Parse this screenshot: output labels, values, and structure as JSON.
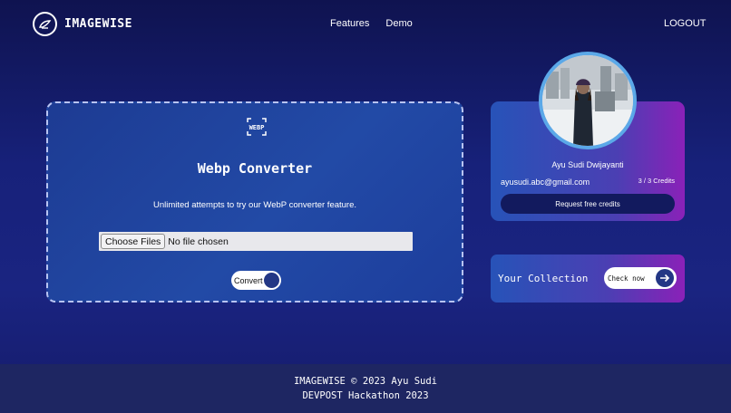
{
  "header": {
    "brand": "IMAGEWISE",
    "nav": [
      "Features",
      "Demo"
    ],
    "logout": "LOGOUT"
  },
  "converter": {
    "icon_label": "WEBP",
    "title": "Webp Converter",
    "description": "Unlimited attempts to try our WebP converter feature.",
    "file_button": "Choose Files",
    "file_status": "No file chosen",
    "convert_label": "Convert"
  },
  "profile": {
    "name": "Ayu Sudi Dwijayanti",
    "email": "ayusudi.abc@gmail.com",
    "credits": "3 / 3 Credits",
    "request_button": "Request free credits"
  },
  "collection": {
    "title": "Your Collection",
    "check_label": "Check now"
  },
  "footer": {
    "line1": "IMAGEWISE © 2023 Ayu Sudi",
    "line2": "DEVPOST Hackathon 2023"
  }
}
